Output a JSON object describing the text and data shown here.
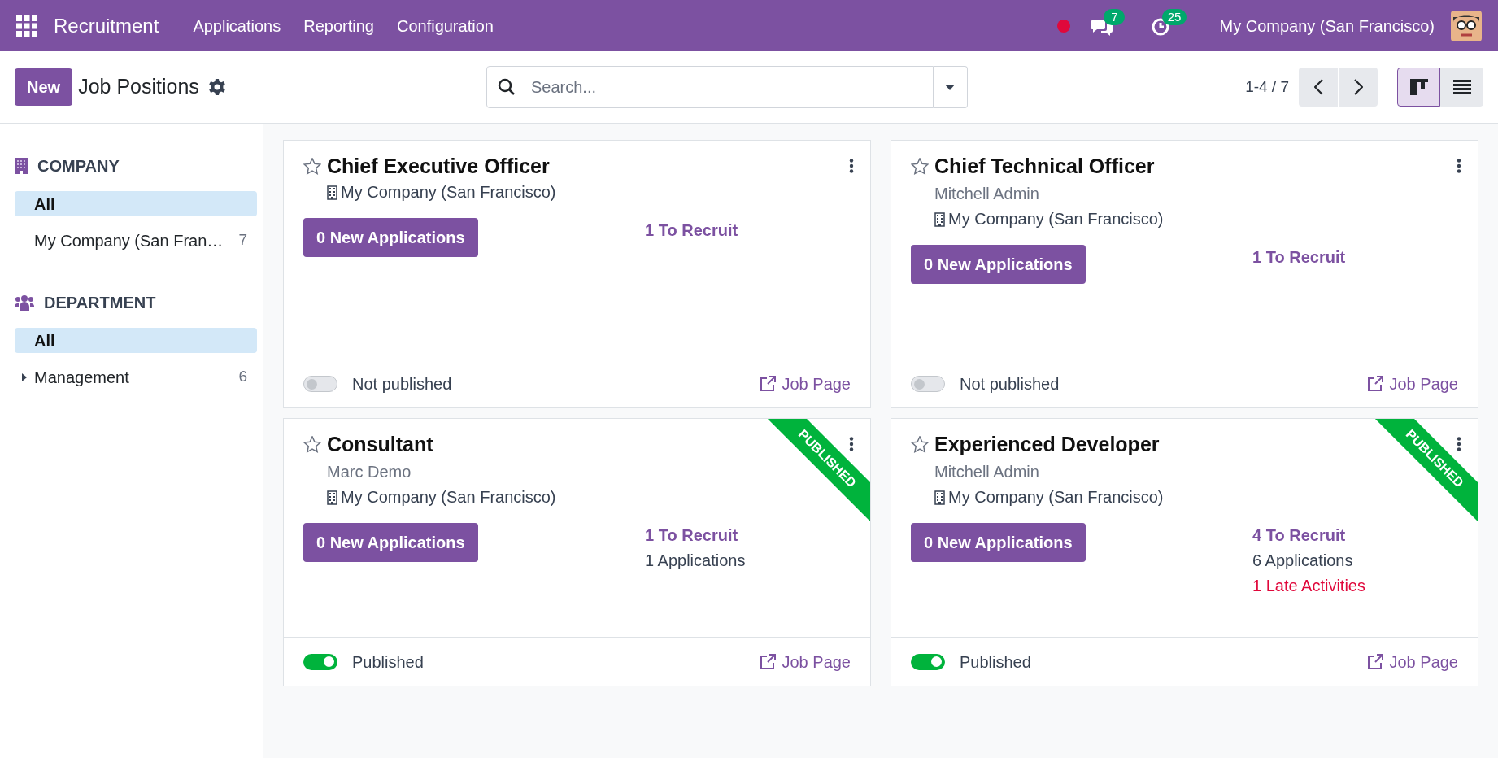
{
  "navbar": {
    "app_name": "Recruitment",
    "menus": [
      "Applications",
      "Reporting",
      "Configuration"
    ],
    "messages_badge": "7",
    "activities_badge": "25",
    "company": "My Company (San Francisco)"
  },
  "control_panel": {
    "new_button": "New",
    "title": "Job Positions",
    "search": {
      "placeholder": "Search..."
    },
    "pager": "1-4 / 7",
    "views": [
      {
        "kind": "kanban",
        "selected": true
      },
      {
        "kind": "list",
        "selected": false
      }
    ]
  },
  "sidebar": [
    {
      "kind": "company",
      "title": "COMPANY",
      "items": [
        {
          "label": "All",
          "selected": true
        },
        {
          "label": "My Company (San Fran…",
          "count": "7",
          "selected": false
        }
      ]
    },
    {
      "kind": "department",
      "title": "DEPARTMENT",
      "items": [
        {
          "label": "All",
          "selected": true
        },
        {
          "label": "Management",
          "count": "6",
          "selected": false,
          "expanded": false
        }
      ]
    }
  ],
  "cards": [
    {
      "title": "Chief Executive Officer",
      "starred": false,
      "company": "My Company (San Francisco)",
      "new_applications": "0 New Applications",
      "to_recruit": "1 To Recruit",
      "published": false,
      "publish_label": "Not published",
      "link": "Job Page"
    },
    {
      "title": "Chief Technical Officer",
      "starred": false,
      "manager": "Mitchell Admin",
      "company": "My Company (San Francisco)",
      "new_applications": "0 New Applications",
      "to_recruit": "1 To Recruit",
      "published": false,
      "publish_label": "Not published",
      "link": "Job Page"
    },
    {
      "title": "Consultant",
      "starred": false,
      "manager": "Marc Demo",
      "company": "My Company (San Francisco)",
      "new_applications": "0 New Applications",
      "to_recruit": "1 To Recruit",
      "applications": "1 Applications",
      "published": true,
      "ribbon": "PUBLISHED",
      "publish_label": "Published",
      "link": "Job Page"
    },
    {
      "title": "Experienced Developer",
      "starred": false,
      "manager": "Mitchell Admin",
      "company": "My Company (San Francisco)",
      "new_applications": "0 New Applications",
      "to_recruit": "4 To Recruit",
      "applications": "6 Applications",
      "late_activities": "1 Late Activities",
      "published": true,
      "ribbon": "PUBLISHED",
      "publish_label": "Published",
      "link": "Job Page"
    }
  ]
}
